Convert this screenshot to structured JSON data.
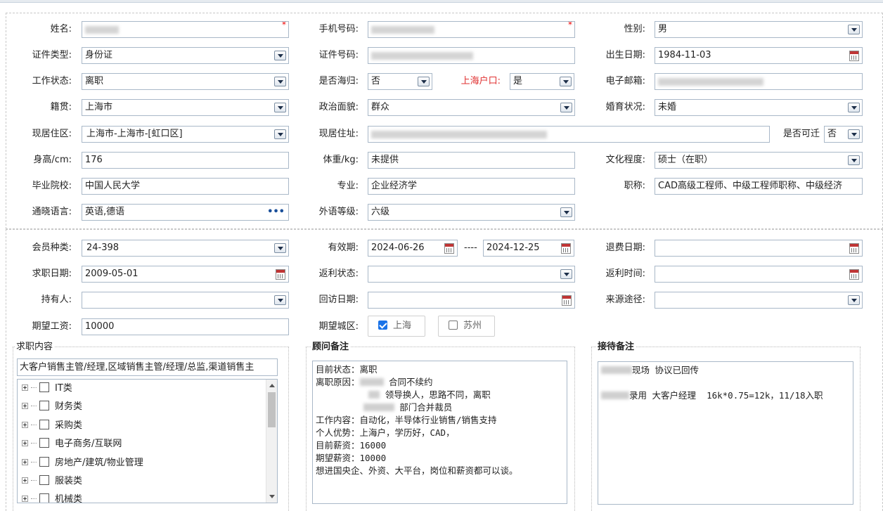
{
  "fields": {
    "name": {
      "label": "姓名:",
      "value": ""
    },
    "phone": {
      "label": "手机号码:",
      "value": ""
    },
    "gender": {
      "label": "性别:",
      "value": "男"
    },
    "id_type": {
      "label": "证件类型:",
      "value": "身份证"
    },
    "id_number": {
      "label": "证件号码:",
      "value": ""
    },
    "birth_date": {
      "label": "出生日期:",
      "value": "1984-11-03"
    },
    "work_status": {
      "label": "工作状态:",
      "value": "离职"
    },
    "overseas_return": {
      "label": "是否海归:",
      "value": "否"
    },
    "shanghai_hukou": {
      "label": "上海户口:",
      "value": "是"
    },
    "email": {
      "label": "电子邮箱:",
      "value": ""
    },
    "native_place": {
      "label": "籍贯:",
      "value": "上海市"
    },
    "political_status": {
      "label": "政治面貌:",
      "value": "群众"
    },
    "marital_status": {
      "label": "婚育状况:",
      "value": "未婚"
    },
    "residence_area": {
      "label": "现居住区:",
      "value": "上海市-上海市-[虹口区]"
    },
    "residence_address": {
      "label": "现居住址:",
      "value": ""
    },
    "relocatable": {
      "label": "是否可迁",
      "value": "否"
    },
    "height": {
      "label": "身高/cm:",
      "value": "176"
    },
    "weight": {
      "label": "体重/kg:",
      "value": "未提供"
    },
    "education": {
      "label": "文化程度:",
      "value": "硕士（在职）"
    },
    "school": {
      "label": "毕业院校:",
      "value": "中国人民大学"
    },
    "major": {
      "label": "专业:",
      "value": "企业经济学"
    },
    "title": {
      "label": "职称:",
      "value": "CAD高级工程师、中级工程师职称、中级经济"
    },
    "languages": {
      "label": "通晓语言:",
      "value": "英语,德语"
    },
    "language_level": {
      "label": "外语等级:",
      "value": "六级"
    },
    "member_type": {
      "label": "会员种类:",
      "value": "24-398"
    },
    "validity": {
      "label": "有效期:",
      "start": "2024-06-26",
      "sep": "----",
      "end": "2024-12-25"
    },
    "refund_date": {
      "label": "退费日期:",
      "value": ""
    },
    "job_search_date": {
      "label": "求职日期:",
      "value": "2009-05-01"
    },
    "rebate_status": {
      "label": "返利状态:",
      "value": ""
    },
    "rebate_time": {
      "label": "返利时间:",
      "value": ""
    },
    "holder": {
      "label": "持有人:",
      "value": ""
    },
    "visit_date": {
      "label": "回访日期:",
      "value": ""
    },
    "source": {
      "label": "来源途径:",
      "value": ""
    },
    "expected_salary": {
      "label": "期望工资:",
      "value": "10000"
    },
    "expected_city": {
      "label": "期望城区:",
      "options": [
        {
          "label": "上海",
          "checked": true
        },
        {
          "label": "苏州",
          "checked": false
        }
      ]
    }
  },
  "job_content": {
    "legend": "求职内容",
    "value": "大客户销售主管/经理,区域销售主管/经理/总监,渠道销售主",
    "tree": [
      "IT类",
      "财务类",
      "采购类",
      "电子商务/互联网",
      "房地产/建筑/物业管理",
      "服装类",
      "机械类"
    ]
  },
  "advisor_notes": {
    "legend": "顾问备注",
    "lines": [
      {
        "pre": "目前状态：离职",
        "blur": 0,
        "post": ""
      },
      {
        "pre": "离职原因：",
        "blur": 34,
        "post": " 合同不续约"
      },
      {
        "pre": "          ",
        "blur": 16,
        "post": " 领导换人，思路不同，离职"
      },
      {
        "pre": "         ",
        "blur": 44,
        "post": " 部门合并裁员"
      },
      {
        "pre": "工作内容：自动化，半导体行业销售/销售支持",
        "blur": 0,
        "post": ""
      },
      {
        "pre": "个人优势：上海户，学历好，CAD，",
        "blur": 0,
        "post": ""
      },
      {
        "pre": "目前薪资：16000",
        "blur": 0,
        "post": ""
      },
      {
        "pre": "期望薪资：10000",
        "blur": 0,
        "post": ""
      },
      {
        "pre": "想进国央企、外资、大平台，岗位和薪资都可以谈。",
        "blur": 0,
        "post": ""
      }
    ]
  },
  "reception_notes": {
    "legend": "接待备注",
    "lines": [
      {
        "blur": 44,
        "post": "现场 协议已回传"
      },
      {
        "blur": 0,
        "post": ""
      },
      {
        "blur": 40,
        "post": "录用 大客户经理  16k*0.75=12k，11/18入职"
      }
    ]
  }
}
